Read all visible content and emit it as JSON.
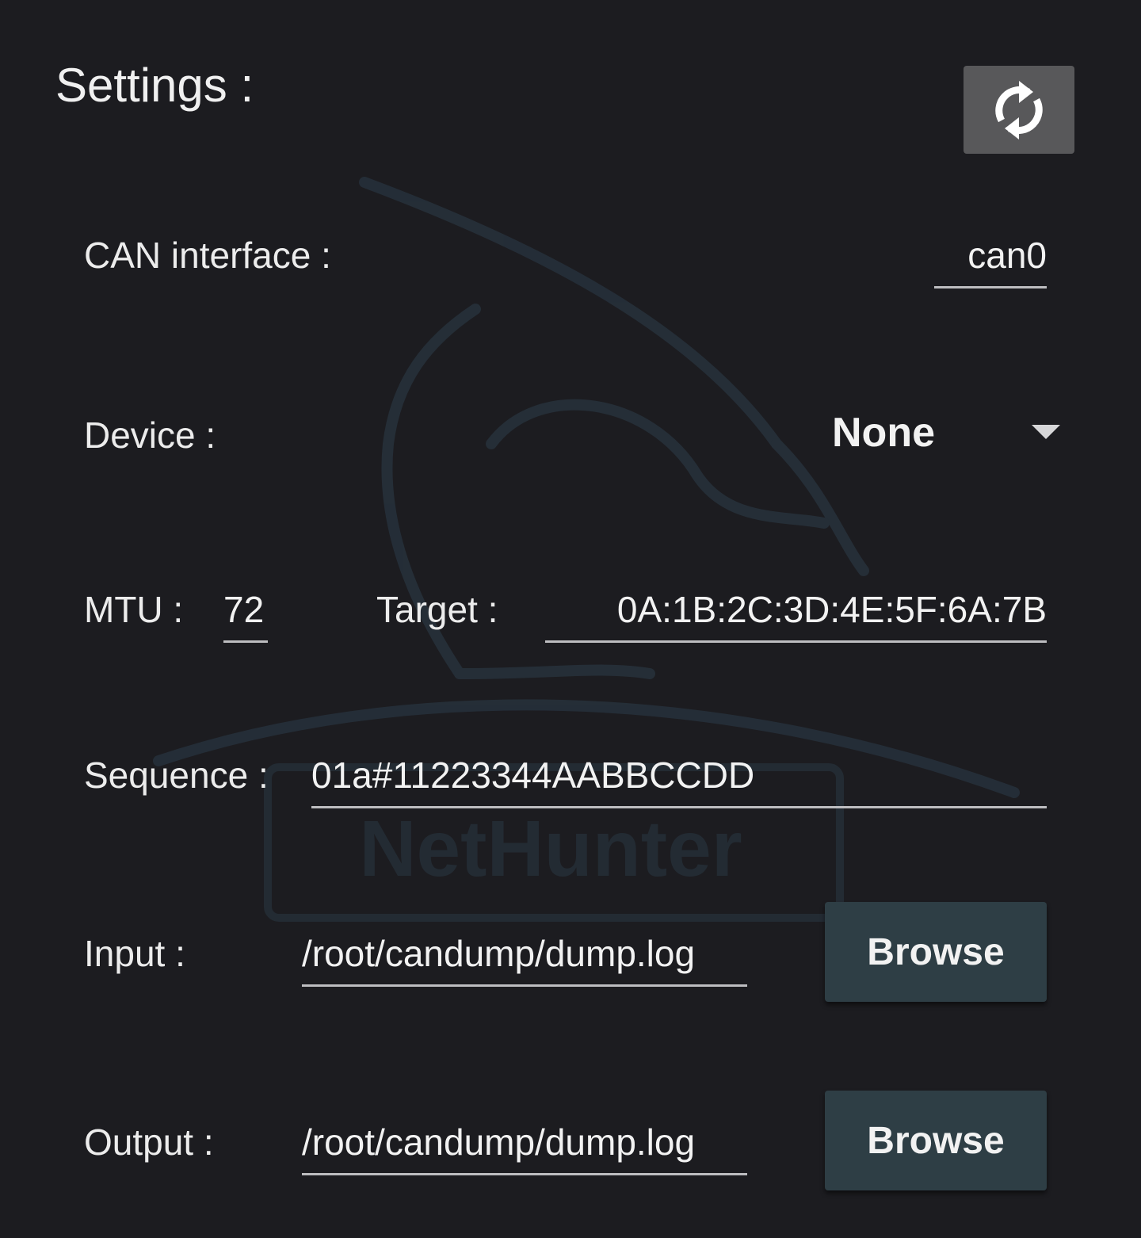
{
  "header": {
    "title": "Settings :",
    "refresh_icon": "refresh-icon"
  },
  "can_interface": {
    "label": "CAN interface :",
    "value": "can0"
  },
  "device": {
    "label": "Device :",
    "selected": "None"
  },
  "mtu": {
    "label": "MTU :",
    "value": "72"
  },
  "target": {
    "label": "Target :",
    "value": "0A:1B:2C:3D:4E:5F:6A:7B"
  },
  "sequence": {
    "label": "Sequence :",
    "value": "01a#11223344AABBCCDD"
  },
  "input": {
    "label": "Input :",
    "value": "/root/candump/dump.log",
    "browse_label": "Browse"
  },
  "output": {
    "label": "Output :",
    "value": "/root/candump/dump.log",
    "browse_label": "Browse"
  },
  "watermark": {
    "text": "NetHunter"
  },
  "colors": {
    "background": "#1c1c20",
    "refresh_button": "#58585a",
    "browse_button": "#2e3e45",
    "underline": "#bdbdc0"
  }
}
